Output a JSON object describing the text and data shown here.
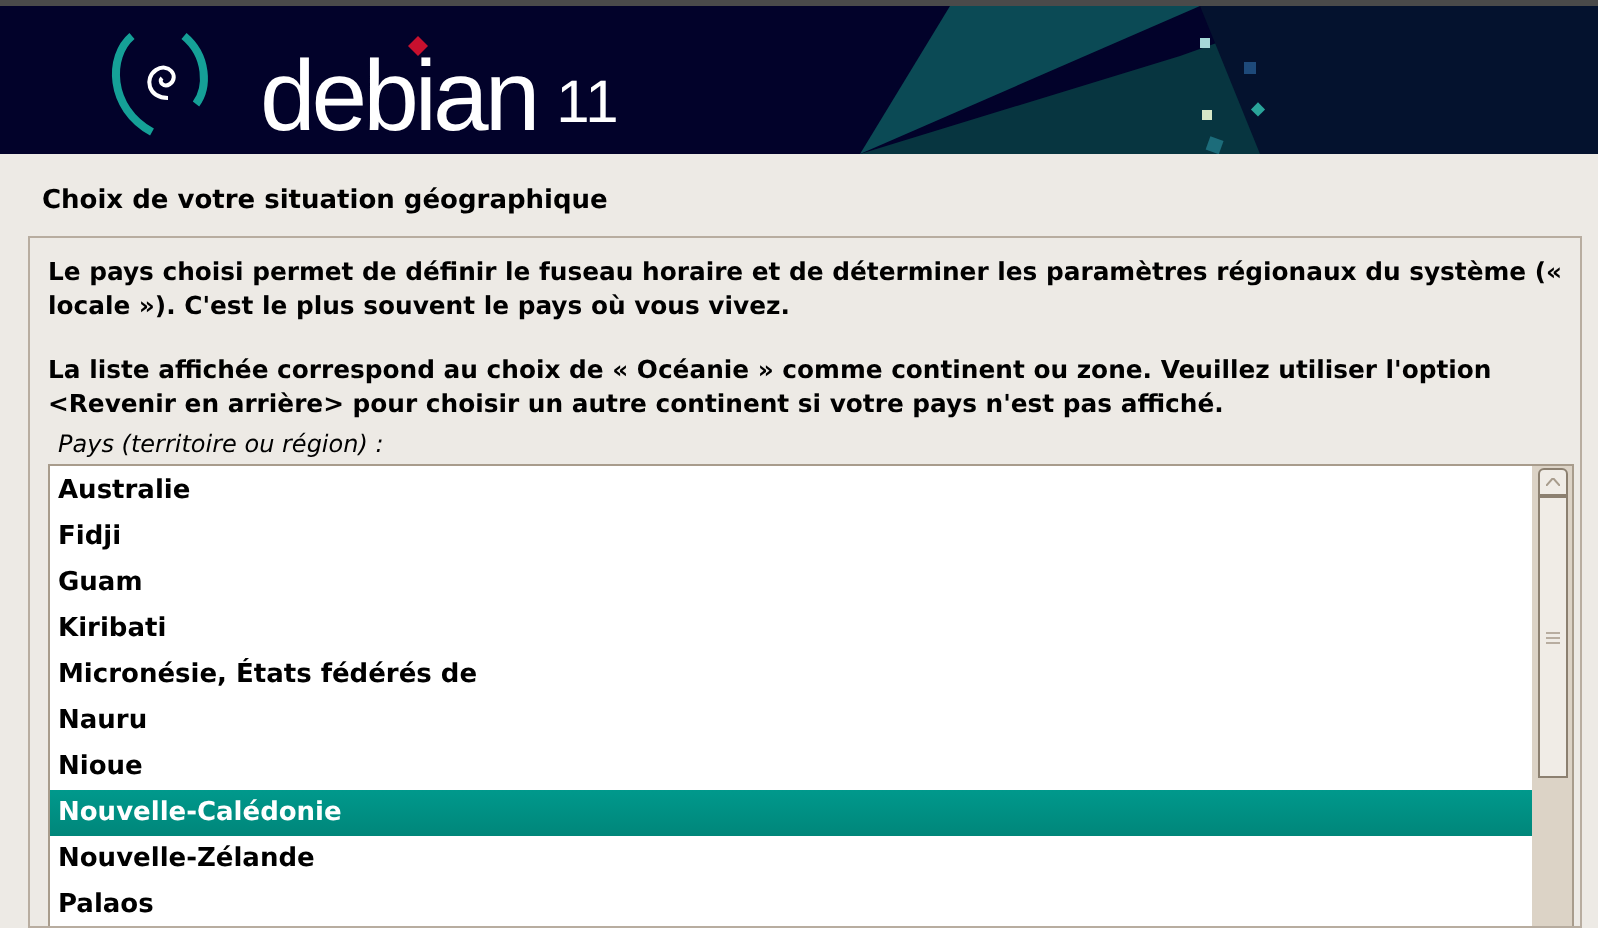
{
  "banner": {
    "logo_text": "debian",
    "version": "11"
  },
  "title": "Choix de votre situation géographique",
  "paragraphs": [
    "Le pays choisi permet de définir le fuseau horaire et de déterminer les paramètres régionaux du système (« locale »). C'est le plus souvent le pays où vous vivez.",
    "La liste affichée correspond au choix de « Océanie » comme continent ou zone. Veuillez utiliser l'option <Revenir en arrière> pour choisir un autre continent si votre pays n'est pas affiché."
  ],
  "list_label": "Pays (territoire ou région) :",
  "countries": [
    {
      "label": "Australie",
      "selected": false
    },
    {
      "label": "Fidji",
      "selected": false
    },
    {
      "label": "Guam",
      "selected": false
    },
    {
      "label": "Kiribati",
      "selected": false
    },
    {
      "label": "Micronésie, États fédérés de",
      "selected": false
    },
    {
      "label": "Nauru",
      "selected": false
    },
    {
      "label": "Nioue",
      "selected": false
    },
    {
      "label": "Nouvelle-Calédonie",
      "selected": true
    },
    {
      "label": "Nouvelle-Zélande",
      "selected": false
    },
    {
      "label": "Palaos",
      "selected": false
    }
  ]
}
